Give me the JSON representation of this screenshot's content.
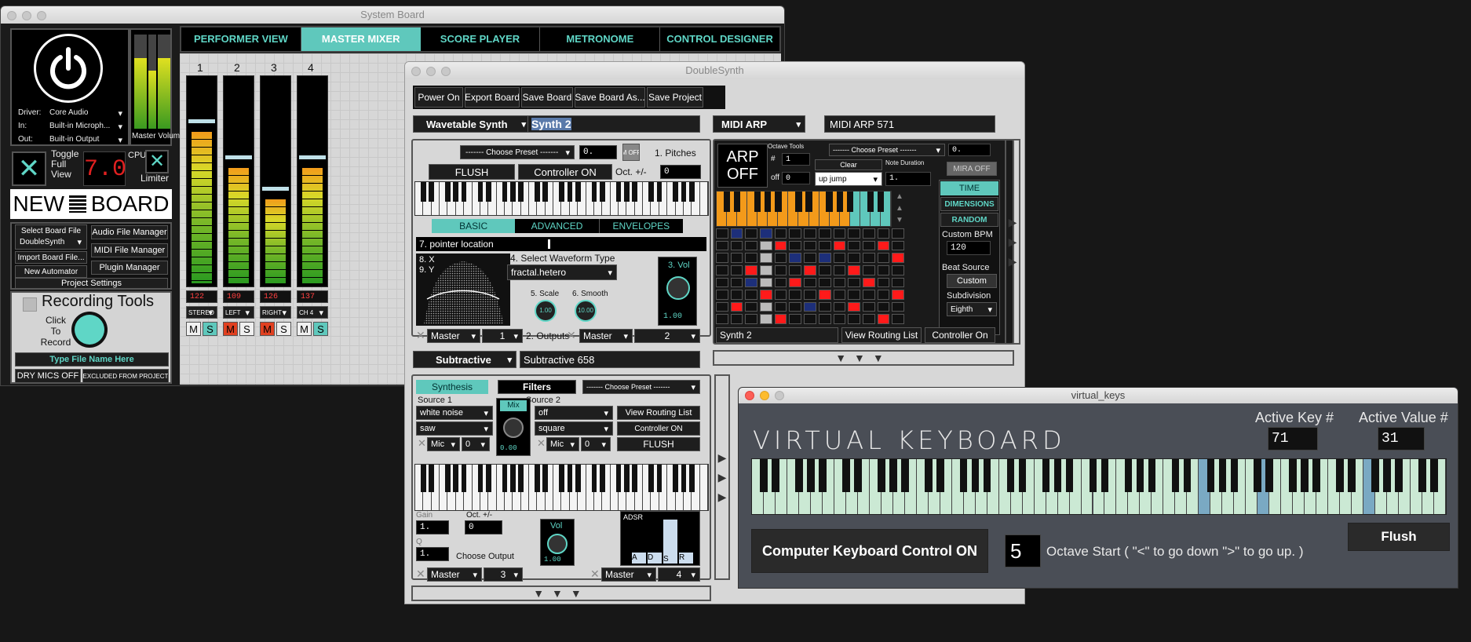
{
  "system_board": {
    "title": "System Board",
    "tabs": [
      "PERFORMER VIEW",
      "MASTER MIXER",
      "SCORE PLAYER",
      "METRONOME",
      "CONTROL DESIGNER"
    ],
    "active_tab": 1,
    "driver_label": "Driver:",
    "driver_value": "Core Audio",
    "in_label": "In:",
    "in_value": "Built-in Microph...",
    "out_label": "Out:",
    "out_value": "Built-in Output",
    "master_volume_label": "Master Volume",
    "toggle_full_view": "Toggle Full View",
    "cpu_value": "7.0",
    "cpu_label": "CPU",
    "limiter_label": "Limiter",
    "new_board": "NEW",
    "new_board2": "BOARD",
    "select_board_file": "Select Board File",
    "board_file_value": "DoubleSynth",
    "import_board_file": "Import Board File...",
    "new_automator": "New Automator",
    "audio_file_manager": "Audio File Manager",
    "midi_file_manager": "MIDI File Manager",
    "plugin_manager": "Plugin Manager",
    "project_settings": "Project Settings",
    "recording_tools": "Recording Tools",
    "click_to_record": "Click To Record",
    "type_file_name": "Type File Name Here",
    "dry_mics": "DRY MICS OFF",
    "excluded": "EXCLUDED FROM PROJECT",
    "channels": [
      {
        "num": "1",
        "value": "122",
        "route": "STEREO",
        "level": 0.77
      },
      {
        "num": "2",
        "value": "109",
        "route": "LEFT",
        "level": 0.6
      },
      {
        "num": "3",
        "value": "126",
        "route": "RIGHT",
        "level": 0.45
      },
      {
        "num": "4",
        "value": "137",
        "route": "CH 4",
        "level": 0.6
      }
    ],
    "m_label": "M",
    "s_label": "S"
  },
  "double_synth": {
    "title": "DoubleSynth",
    "toolbar": [
      "Power On",
      "Export Board",
      "Save Board",
      "Save Board As...",
      "Save Project"
    ],
    "synth1_type": "Wavetable Synth",
    "synth1_name": "Synth 2",
    "choose_preset": "------- Choose Preset -------",
    "preset_num": "0.",
    "s": "s",
    "m_off": "M OFF",
    "pitches": "1. Pitches",
    "flush": "FLUSH",
    "controller_on": "Controller ON",
    "oct": "Oct. +/-",
    "oct_value": "0",
    "subtabs": [
      "BASIC",
      "ADVANCED",
      "ENVELOPES"
    ],
    "pointer_location": "7. pointer location",
    "xy_x": "8. X",
    "xy_y": "9. Y",
    "select_waveform": "4. Select Waveform Type",
    "waveform_value": "fractal.hetero",
    "scale_label": "5. Scale",
    "smooth_label": "6. Smooth",
    "scale_value": "1.00",
    "smooth_value": "10.00",
    "vol_label": "3. Vol",
    "vol_value": "1.00",
    "out_master": "Master",
    "out_1": "1",
    "outputs_label": "2. Outputs",
    "out_master2": "Master",
    "out_2": "2",
    "synth2_type": "Subtractive",
    "synth2_name": "Subtractive 658",
    "synthesis": "Synthesis",
    "filters": "Filters",
    "source1": "Source 1",
    "source2": "Source 2",
    "src1_a": "white noise",
    "src1_b": "saw",
    "mix_label": "Mix",
    "mix_value": "0.00",
    "src2_a": "off",
    "src2_b": "square",
    "mic": "Mic",
    "mic_val": "0",
    "view_routing": "View Routing List",
    "controller_on2": "Controller ON",
    "flush2": "FLUSH",
    "gain": "Gain",
    "gain_val": "1.",
    "oct2": "Oct. +/-",
    "oct2_val": "0",
    "q": "Q",
    "q_val": "1.",
    "choose_output": "Choose Output",
    "vol2": "Vol",
    "vol2_val": "1.00",
    "adsr": "ADSR",
    "adsr_letters": [
      "A",
      "D",
      "S",
      "R"
    ],
    "master_b": "Master",
    "master_b_num": "3",
    "master_c": "Master",
    "master_c_num": "4",
    "arp_type": "MIDI ARP",
    "arp_name": "MIDI ARP 571",
    "arp_off": "ARP OFF",
    "octave_tools": "Octave Tools",
    "hash": "#",
    "hash_val": "1",
    "off": "off",
    "off_val": "0",
    "clear": "Clear",
    "up_jump": "up jump",
    "note_duration": "Note Duration",
    "nd_val": "1.",
    "mira_off": "MIRA OFF",
    "time": "TIME",
    "dimensions": "DIMENSIONS",
    "random": "RANDOM",
    "custom_bpm": "Custom BPM",
    "bpm_val": "120",
    "beat_source": "Beat Source",
    "custom": "Custom",
    "subdivision": "Subdivision",
    "eighth": "Eighth",
    "arp_synth": "Synth 2",
    "view_routing2": "View Routing List",
    "controller_on3": "Controller On",
    "colors": {
      "orange": "#f39a1a",
      "red": "#ff1a1a",
      "navy": "#1d2f7a",
      "teal": "#5fc8bc"
    }
  },
  "virtual_keys": {
    "title": "virtual_keys",
    "heading": "VIRTUAL KEYBOARD",
    "active_key_label": "Active Key #",
    "active_key": "71",
    "active_value_label": "Active Value #",
    "active_value": "31",
    "computer_kb": "Computer Keyboard Control ON",
    "octave_val": "5",
    "octave_text": "Octave Start ( \"<\" to go down \">\" to go up. )",
    "flush": "Flush",
    "key_color": "#cbe9d4",
    "highlight_color": "#7aa9c3"
  }
}
